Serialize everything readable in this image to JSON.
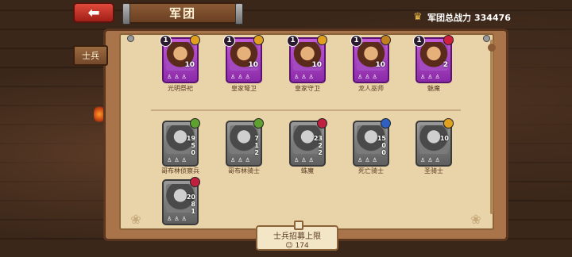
{
  "header": {
    "back_icon": "back-arrow-icon",
    "title": "军团",
    "power_label": "军团总战力",
    "power_value": "334476",
    "power_icon": "crown-icon"
  },
  "sidebar": {
    "tab_label": "士兵"
  },
  "owned_units": [
    {
      "level": "1",
      "name": "光明祭祀",
      "stat": "10",
      "element_color": "#e0a020"
    },
    {
      "level": "1",
      "name": "皇家弩卫",
      "stat": "10",
      "element_color": "#e0a020"
    },
    {
      "level": "1",
      "name": "皇家守卫",
      "stat": "10",
      "element_color": "#e0a020"
    },
    {
      "level": "1",
      "name": "龙人巫师",
      "stat": "10",
      "element_color": "#c08020"
    },
    {
      "level": "1",
      "name": "魅魔",
      "stat": "2",
      "element_color": "#d02040"
    }
  ],
  "locked_units": [
    {
      "name": "哥布林侦察兵",
      "stats": [
        "19",
        "5",
        "0"
      ],
      "element_color": "#60a030"
    },
    {
      "name": "哥布林骑士",
      "stats": [
        "7",
        "1",
        "2"
      ],
      "element_color": "#60a030"
    },
    {
      "name": "蛛魔",
      "stats": [
        "23",
        "2",
        "2"
      ],
      "element_color": "#c02040"
    },
    {
      "name": "死亡骑士",
      "stats": [
        "15",
        "0",
        "0"
      ],
      "element_color": "#3060c0"
    },
    {
      "name": "圣骑士",
      "stats": [
        "10",
        "",
        ""
      ],
      "element_color": "#e0a020"
    },
    {
      "name": "",
      "stats": [
        "20",
        "8",
        "1"
      ],
      "element_color": "#c02040"
    }
  ],
  "recruit": {
    "label": "士兵招募上限",
    "value": "174"
  }
}
